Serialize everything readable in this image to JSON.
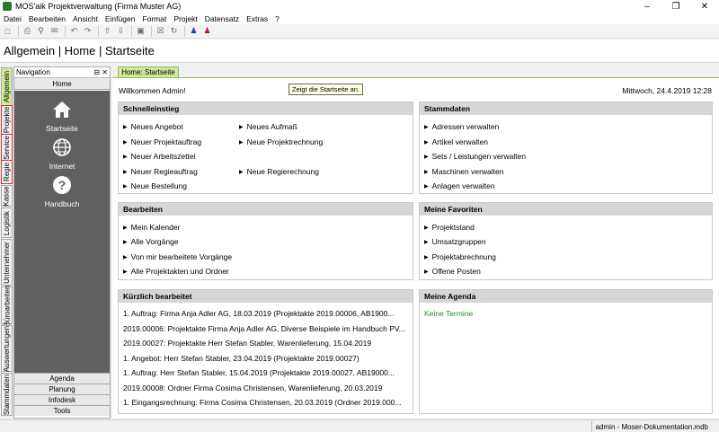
{
  "window": {
    "title": "MOS'aik Projektverwaltung (Firma Muster AG)"
  },
  "menu": [
    "Datei",
    "Bearbeiten",
    "Ansicht",
    "Einfügen",
    "Format",
    "Projekt",
    "Datensatz",
    "Extras",
    "?"
  ],
  "page_title": "Allgemein | Home | Startseite",
  "vtabs": [
    "Allgemein",
    "Projekte",
    "Service",
    "Regie",
    "Kasse",
    "Logistik",
    "Unternehmer",
    "Büroarbeiten",
    "Auswertungen",
    "Stammdaten"
  ],
  "nav": {
    "title": "Navigation",
    "home": "Home",
    "items": [
      {
        "label": "Startseite",
        "icon": "house-icon"
      },
      {
        "label": "Internet",
        "icon": "globe-icon"
      },
      {
        "label": "Handbuch",
        "icon": "help-icon"
      }
    ],
    "bottom": [
      "Agenda",
      "Planung",
      "Infodesk",
      "Tools"
    ]
  },
  "doc_tab": "Home: Startseite",
  "welcome": "Willkommen Admin!",
  "tooltip": "Zeigt die Startseite an.",
  "datetime": "Mittwoch, 24.4.2019 12:28",
  "schnelleinstieg": {
    "title": "Schnelleinstieg",
    "col1": [
      "Neues Angebot",
      "Neuer Projektauftrag",
      "Neuer Arbeitszettel",
      "Neuer Regieauftrag",
      "Neue Bestellung"
    ],
    "col2": [
      "Neues Aufmaß",
      "Neue Projektrechnung",
      "Neue Regierechnung"
    ]
  },
  "stammdaten": {
    "title": "Stammdaten",
    "items": [
      "Adressen verwalten",
      "Artikel verwalten",
      "Sets / Leistungen verwalten",
      "Maschinen verwalten",
      "Anlagen verwalten"
    ]
  },
  "bearbeiten": {
    "title": "Bearbeiten",
    "items": [
      "Mein Kalender",
      "Alle Vorgänge",
      "Von mir bearbeitete Vorgänge",
      "Alle Projektakten und Ordner"
    ]
  },
  "favoriten": {
    "title": "Meine Favoriten",
    "items": [
      "Projektstand",
      "Umsatzgruppen",
      "Projektabrechnung",
      "Offene Posten"
    ]
  },
  "kuerzlich": {
    "title": "Kürzlich bearbeitet",
    "items": [
      "1. Auftrag: Firma Anja Adler AG, 18.03.2019 (Projektakte 2019.00006, AB1900...",
      "2019.00006: Projektakte Firma Anja Adler AG, Diverse Beispiele im Handbuch PV...",
      "2019.00027: Projektakte Herr Stefan Stabler, Warenlieferung, 15.04.2019",
      "1. Angebot: Herr Stefan Stabler, 23.04.2019 (Projektakte 2019.00027)",
      "1. Auftrag: Herr Stefan Stabler, 15.04.2019 (Projektakte 2019.00027, AB19000...",
      "2019.00008: Ordner Firma Cosima Christensen, Warenlieferung, 20.03.2019",
      "1. Eingangsrechnung: Firma Cosima Christensen, 20.03.2019 (Ordner 2019.000..."
    ]
  },
  "agenda": {
    "title": "Meine Agenda",
    "empty": "Keine Termine"
  },
  "status": "admin - Moser-Dokumentation.mdb"
}
